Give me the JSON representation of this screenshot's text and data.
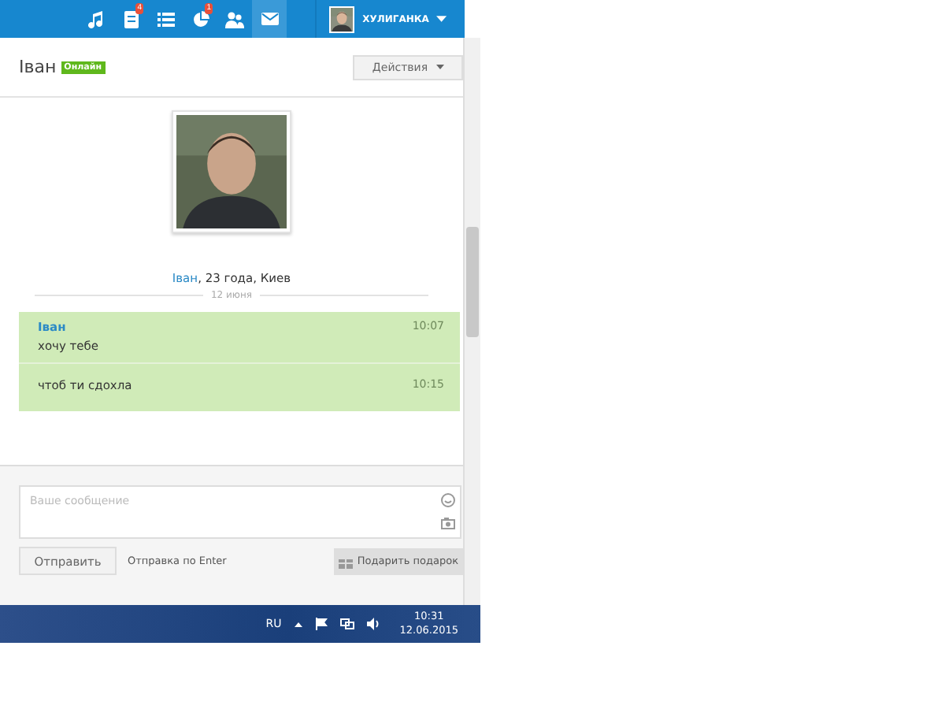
{
  "top_bar": {
    "nav": [
      {
        "kind": "music",
        "selected": false
      },
      {
        "kind": "feed",
        "badge": "4",
        "selected": false
      },
      {
        "kind": "list",
        "selected": false
      },
      {
        "kind": "chart",
        "badge": "1",
        "selected": false
      },
      {
        "kind": "people",
        "selected": false
      },
      {
        "kind": "mail",
        "selected": true
      }
    ],
    "user": {
      "name": "ХУЛИГАНКА"
    }
  },
  "header": {
    "name": "Іван",
    "status": "Онлайн",
    "actions_button": "Действия"
  },
  "profile": {
    "name": "Іван",
    "details": ", 23 года, Киев"
  },
  "date_divider": "12 июня",
  "messages": [
    {
      "author": "Іван",
      "text": "хочу тебе",
      "time": "10:07"
    },
    {
      "text": "чтоб ти сдохла",
      "time": "10:15"
    }
  ],
  "composer": {
    "placeholder": "Ваше сообщение",
    "send_button": "Отправить",
    "send_hint": "Отправка по Enter",
    "gift_button": "Подарить подарок"
  },
  "taskbar": {
    "language": "RU",
    "time": "10:31",
    "date": "12.06.2015"
  }
}
